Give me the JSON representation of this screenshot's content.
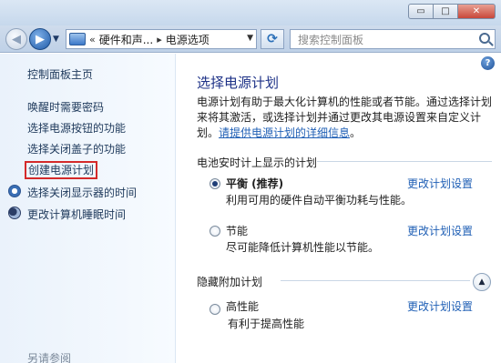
{
  "window": {
    "minimize": "▭",
    "maximize": "□",
    "close": "✕"
  },
  "nav": {
    "breadcrumb_overflow": "«",
    "breadcrumb_1": "硬件和声...",
    "breadcrumb_2": "电源选项",
    "separator": "▸",
    "search_placeholder": "搜索控制面板"
  },
  "sidebar": {
    "home": "控制面板主页",
    "items": [
      {
        "label": "唤醒时需要密码"
      },
      {
        "label": "选择电源按钮的功能"
      },
      {
        "label": "选择关闭盖子的功能"
      },
      {
        "label": "创建电源计划"
      },
      {
        "label": "选择关闭显示器的时间"
      },
      {
        "label": "更改计算机睡眠时间"
      }
    ],
    "see_also": "另请参阅"
  },
  "main": {
    "title": "选择电源计划",
    "description": "电源计划有助于最大化计算机的性能或者节能。通过选择计划来将其激活，或选择计划并通过更改其电源设置来自定义计划。",
    "description_link": "请提供电源计划的详细信息",
    "description_end": "。",
    "battery_group": "电池安时计上显示的计划",
    "hidden_group": "隐藏附加计划",
    "plans": [
      {
        "name": "平衡 (推荐)",
        "desc": "利用可用的硬件自动平衡功耗与性能。",
        "link": "更改计划设置",
        "selected": true
      },
      {
        "name": "节能",
        "desc": "尽可能降低计算机性能以节能。",
        "link": "更改计划设置",
        "selected": false
      },
      {
        "name": "高性能",
        "desc": "有利于提高性能",
        "link": "更改计划设置",
        "selected": false
      }
    ]
  },
  "colors": {
    "link": "#1f5fb5",
    "title": "#1e3287",
    "highlight_box": "#d42a2a"
  }
}
